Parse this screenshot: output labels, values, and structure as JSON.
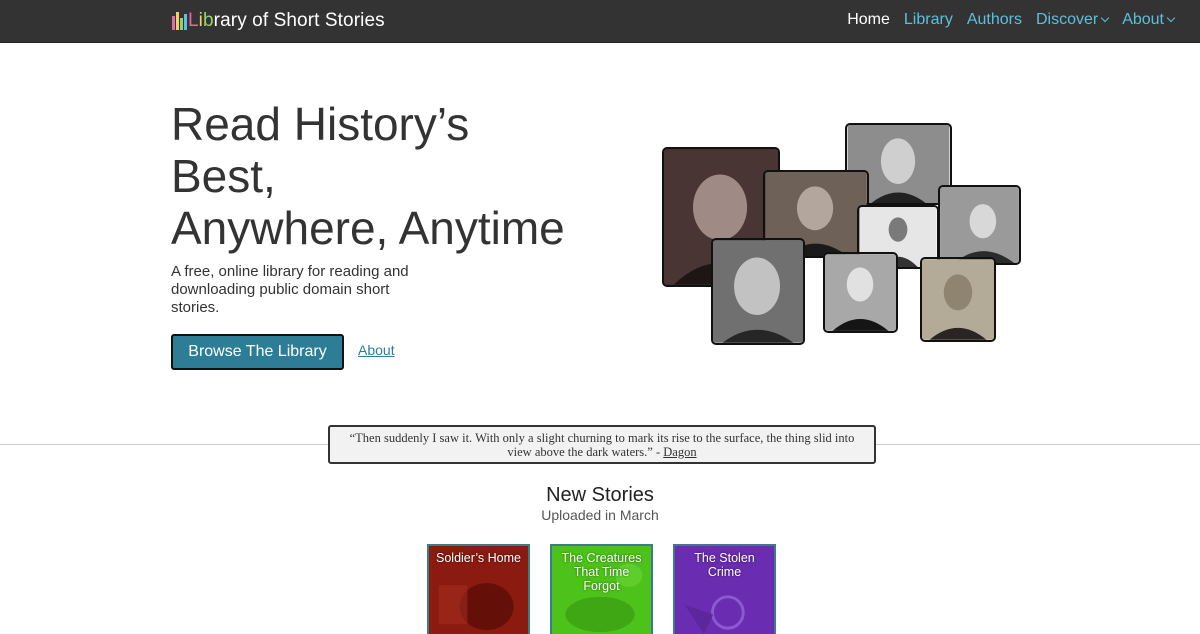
{
  "navbar": {
    "brand": {
      "part1": "L",
      "part2": "i",
      "part3": "b",
      "rest": "rary of Short Stories"
    },
    "links": [
      {
        "label": "Home",
        "active": true
      },
      {
        "label": "Library"
      },
      {
        "label": "Authors"
      },
      {
        "label": "Discover",
        "dropdown": true
      },
      {
        "label": "About",
        "dropdown": true
      }
    ]
  },
  "hero": {
    "title_lines": [
      "Read History’s",
      "Best,",
      "Anywhere, Anytime"
    ],
    "subtitle": "A free, online library for reading and downloading public domain short stories.",
    "browse_button": "Browse The Library",
    "about_link": "About"
  },
  "quote": {
    "text": "“Then suddenly I saw it. With only a slight churning to mark its rise to the surface, the thing slid into view above the dark waters.” - ",
    "source": "Dagon"
  },
  "new_stories": {
    "title": "New Stories",
    "subtitle": "Uploaded in March",
    "books": [
      {
        "title": "Soldier’s Home",
        "color": "#8b1a10"
      },
      {
        "title": "The Creatures That Time Forgot",
        "color": "#4cc21a"
      },
      {
        "title": "The Stolen Crime",
        "color": "#6a2cb0"
      }
    ]
  },
  "colors": {
    "navbar": "#333333",
    "accent": "#2e7d97",
    "nav_link": "#5bc0de"
  }
}
